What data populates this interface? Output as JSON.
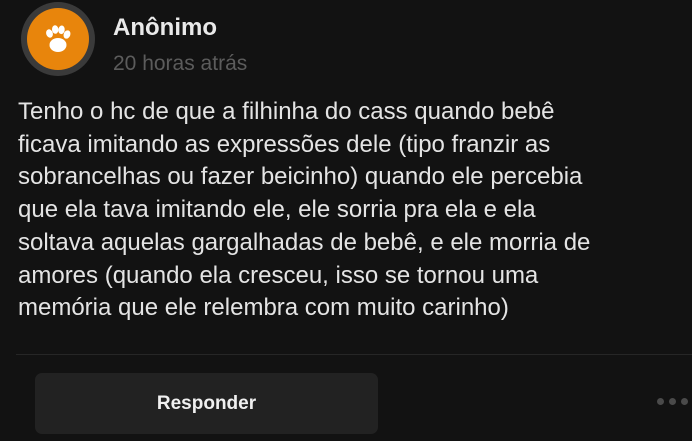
{
  "post": {
    "author": "Anônimo",
    "time": "20 horas atrás",
    "body_lines": [
      "Tenho o hc de que a filhinha do cass quando bebê",
      "ficava imitando as expressões dele (tipo franzir as",
      "sobrancelhas ou fazer beicinho) quando ele percebia",
      "que ela tava imitando ele, ele sorria pra ela e ela",
      "soltava aquelas gargalhadas de bebê, e ele morria de",
      "amores (quando ela cresceu, isso se tornou uma",
      "memória que ele relembra com muito carinho)"
    ]
  },
  "actions": {
    "reply_label": "Responder",
    "more_icon": "ellipsis-icon"
  },
  "avatar": {
    "icon": "paw-icon",
    "color": "#e8850c"
  },
  "colors": {
    "background": "#121212",
    "text": "#e4e4e4",
    "muted": "#5c5c5c",
    "button": "#222222"
  }
}
